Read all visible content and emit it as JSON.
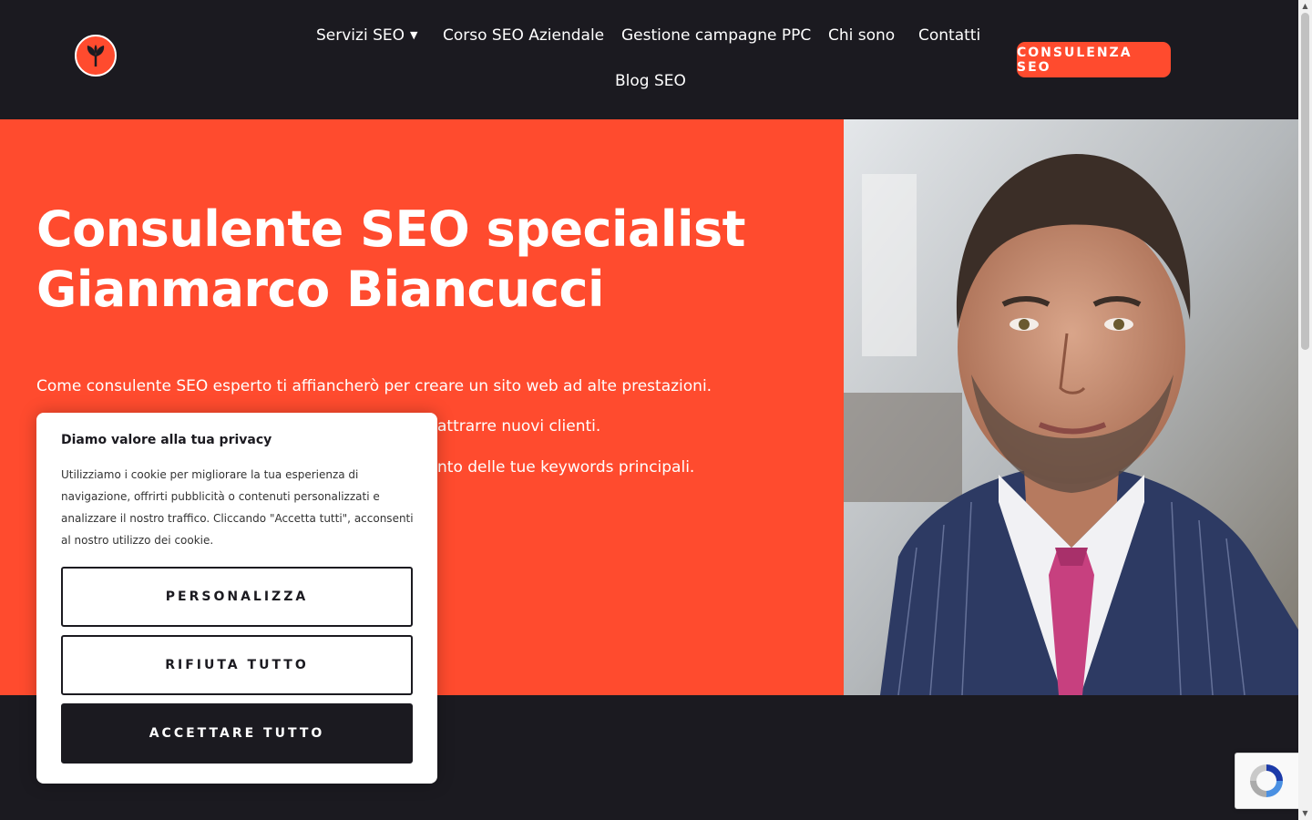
{
  "header": {
    "logo_icon": "sprout-leaf-icon",
    "nav": [
      {
        "label": "Servizi SEO",
        "has_dropdown": true
      },
      {
        "label": "Corso SEO Aziendale"
      },
      {
        "label": "Gestione campagne PPC"
      },
      {
        "label": "Chi sono"
      },
      {
        "label": "Contatti"
      },
      {
        "label": "Blog SEO"
      }
    ],
    "cta_label": "CONSULENZA SEO"
  },
  "hero": {
    "title_line1": "Consulente SEO specialist",
    "title_line2": "Gianmarco Biancucci",
    "lines": [
      "Come consulente SEO esperto ti affiancherò per creare un sito web ad alte prestazioni.",
      "attrarre nuovi clienti.",
      "nto delle tue keywords principali."
    ]
  },
  "cookie": {
    "title": "Diamo valore alla tua privacy",
    "text": "Utilizziamo i cookie per migliorare la tua esperienza di navigazione, offrirti pubblicità o contenuti personalizzati e analizzare il nostro traffico. Cliccando \"Accetta tutti\", acconsenti al nostro utilizzo dei cookie.",
    "customize_label": "PERSONALIZZA",
    "reject_label": "RIFIUTA TUTTO",
    "accept_label": "ACCETTARE TUTTO"
  },
  "colors": {
    "accent": "#ff4b2e",
    "dark": "#1b1a20"
  }
}
